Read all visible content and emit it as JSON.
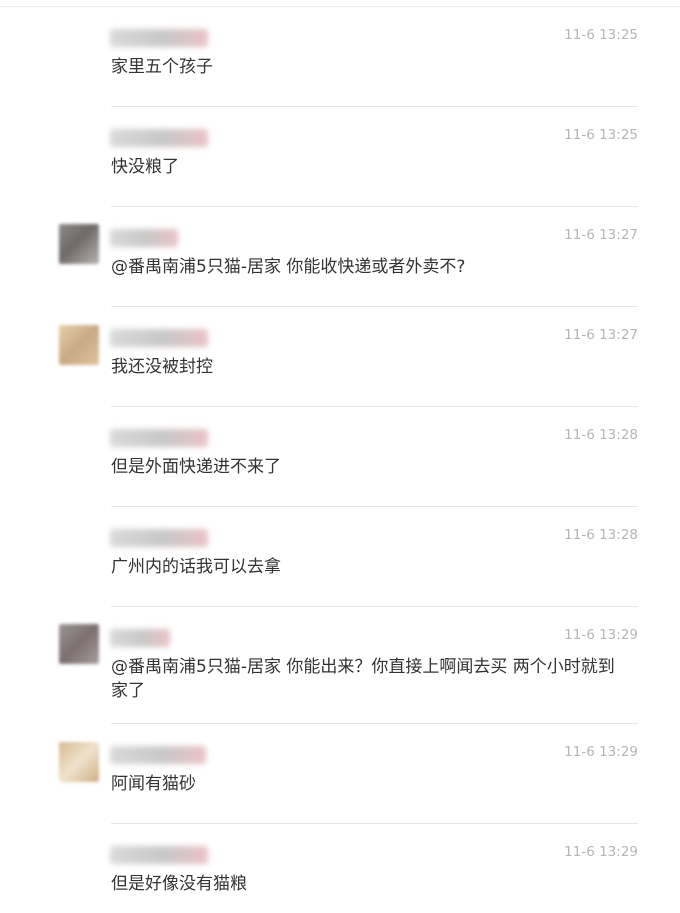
{
  "comments": [
    {
      "time": "11-6 13:25",
      "text": "家里五个孩子"
    },
    {
      "time": "11-6 13:25",
      "text": "快没粮了"
    },
    {
      "time": "11-6 13:27",
      "text": "@番禺南浦5只猫-居家 你能收快递或者外卖不?"
    },
    {
      "time": "11-6 13:27",
      "text": "我还没被封控"
    },
    {
      "time": "11-6 13:28",
      "text": "但是外面快递进不来了"
    },
    {
      "time": "11-6 13:28",
      "text": "广州内的话我可以去拿"
    },
    {
      "time": "11-6 13:29",
      "text": "@番禺南浦5只猫-居家 你能出来？你直接上啊闻去买 两个小时就到家了"
    },
    {
      "time": "11-6 13:29",
      "text": "阿闻有猫砂"
    },
    {
      "time": "11-6 13:29",
      "text": "但是好像没有猫粮"
    }
  ]
}
